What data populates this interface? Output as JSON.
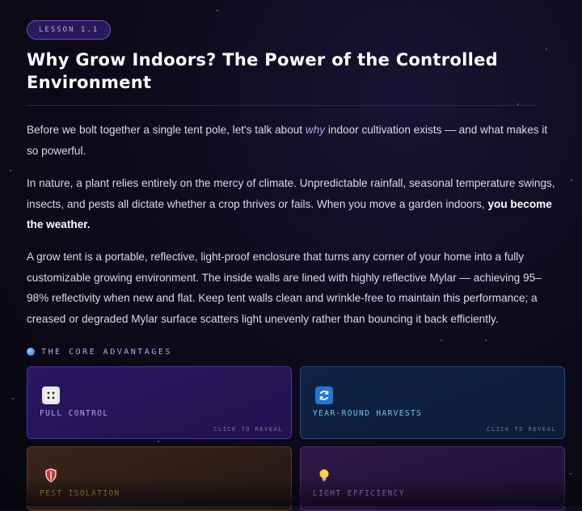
{
  "lesson": {
    "badge": "LESSON 1.1"
  },
  "page": {
    "title": "Why Grow Indoors? The Power of the Controlled Environment"
  },
  "paragraphs": {
    "p1_before": "Before we bolt together a single tent pole, let's talk about ",
    "p1_em": "why",
    "p1_after": " indoor cultivation exists — and what makes it so powerful.",
    "p2_before": "In nature, a plant relies entirely on the mercy of climate. Unpredictable rainfall, seasonal temperature swings, insects, and pests all dictate whether a crop thrives or fails. When you move a garden indoors, ",
    "p2_bold": "you become the weather.",
    "p3": "A grow tent is a portable, reflective, light-proof enclosure that turns any corner of your home into a fully customizable growing environment. The inside walls are lined with highly reflective Mylar — achieving 95–98% reflectivity when new and flat. Keep tent walls clean and wrinkle-free to maintain this performance; a creased or degraded Mylar surface scatters light unevenly rather than bouncing it back efficiently."
  },
  "section": {
    "title": "THE CORE ADVANTAGES",
    "icon": "globe-icon"
  },
  "cards": [
    {
      "label": "FULL CONTROL",
      "icon": "dice-icon",
      "hint": "CLICK TO REVEAL",
      "accent": "#b6a6f0"
    },
    {
      "label": "YEAR-ROUND HARVESTS",
      "icon": "cycle-icon",
      "hint": "CLICK TO REVEAL",
      "accent": "#6ac8e6"
    },
    {
      "label": "PEST ISOLATION",
      "icon": "shield-icon",
      "accent": "#d79a3a"
    },
    {
      "label": "LIGHT EFFICIENCY",
      "icon": "lightbulb-icon",
      "accent": "#b39be0"
    }
  ]
}
